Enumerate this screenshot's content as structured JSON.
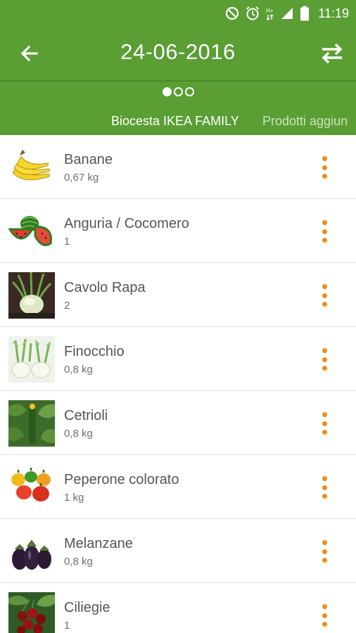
{
  "status_bar": {
    "time": "11:19",
    "icons": [
      "do-not-disturb-icon",
      "alarm-icon",
      "hplus-network-icon",
      "signal-icon",
      "battery-icon"
    ],
    "network_label": "H+"
  },
  "toolbar": {
    "title": "24-06-2016",
    "back_icon": "arrow-left-icon",
    "swap_icon": "swap-horizontal-icon"
  },
  "pager": {
    "pages": 3,
    "active_index": 0
  },
  "tabs": [
    {
      "label": "Biocesta IKEA FAMILY",
      "active": true
    },
    {
      "label": "Prodotti aggiun",
      "active": false
    }
  ],
  "products": [
    {
      "name": "Banane",
      "quantity": "0,67 kg",
      "image": "bananas"
    },
    {
      "name": "Anguria / Cocomero",
      "quantity": "1",
      "image": "watermelon"
    },
    {
      "name": "Cavolo Rapa",
      "quantity": "2",
      "image": "kohlrabi"
    },
    {
      "name": "Finocchio",
      "quantity": "0,8 kg",
      "image": "fennel"
    },
    {
      "name": "Cetrioli",
      "quantity": "0,8 kg",
      "image": "cucumber"
    },
    {
      "name": "Peperone colorato",
      "quantity": "1 kg",
      "image": "peppers"
    },
    {
      "name": "Melanzane",
      "quantity": "0,8 kg",
      "image": "eggplant"
    },
    {
      "name": "Ciliegie",
      "quantity": "1",
      "image": "cherries"
    }
  ],
  "colors": {
    "header_green": "#5a9e34",
    "menu_orange": "#f28c18",
    "text_primary": "#555555",
    "text_secondary": "#6f6f6f"
  }
}
